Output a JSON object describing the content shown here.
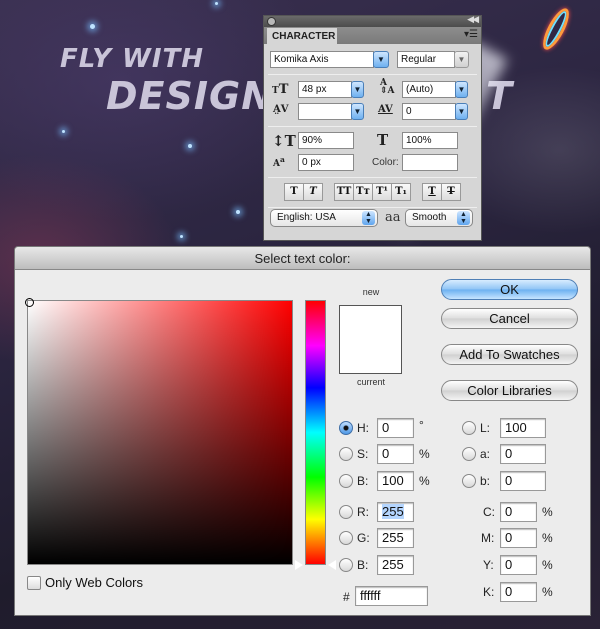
{
  "background": {
    "headline_line1": "FLY WITH",
    "headline_line2": "DESIGN",
    "headline_tail": "T"
  },
  "character_panel": {
    "tab_label": "CHARACTER",
    "menu_icon": "panel-menu-icon",
    "font_family": "Komika Axis",
    "font_style": "Regular",
    "font_size": "48 px",
    "leading": "(Auto)",
    "kerning": "",
    "tracking": "0",
    "vertical_scale": "90%",
    "horizontal_scale": "100%",
    "baseline_shift": "0 px",
    "color_label": "Color:",
    "style_buttons": [
      "T",
      "T",
      "TT",
      "Tт",
      "T¹",
      "T₁",
      "T",
      "T"
    ],
    "language": "English: USA",
    "antialias_icon_label": "aa",
    "antialias": "Smooth"
  },
  "color_dialog": {
    "title": "Select text color:",
    "new_label": "new",
    "current_label": "current",
    "new_color": "#ffffff",
    "current_color": "#ffffff",
    "buttons": {
      "ok": "OK",
      "cancel": "Cancel",
      "add_to_swatches": "Add To Swatches",
      "color_libraries": "Color Libraries"
    },
    "hsb": [
      {
        "label": "H:",
        "value": "0",
        "unit": "°",
        "selected": true
      },
      {
        "label": "S:",
        "value": "0",
        "unit": "%",
        "selected": false
      },
      {
        "label": "B:",
        "value": "100",
        "unit": "%",
        "selected": false
      }
    ],
    "rgb": [
      {
        "label": "R:",
        "value": "255"
      },
      {
        "label": "G:",
        "value": "255"
      },
      {
        "label": "B:",
        "value": "255"
      }
    ],
    "lab": [
      {
        "label": "L:",
        "value": "100"
      },
      {
        "label": "a:",
        "value": "0"
      },
      {
        "label": "b:",
        "value": "0"
      }
    ],
    "cmyk": [
      {
        "label": "C:",
        "value": "0",
        "unit": "%"
      },
      {
        "label": "M:",
        "value": "0",
        "unit": "%"
      },
      {
        "label": "Y:",
        "value": "0",
        "unit": "%"
      },
      {
        "label": "K:",
        "value": "0",
        "unit": "%"
      }
    ],
    "hex_label": "#",
    "hex_value": "ffffff",
    "only_web_colors_label": "Only Web Colors",
    "only_web_colors_checked": false,
    "hue_degrees": 0
  }
}
